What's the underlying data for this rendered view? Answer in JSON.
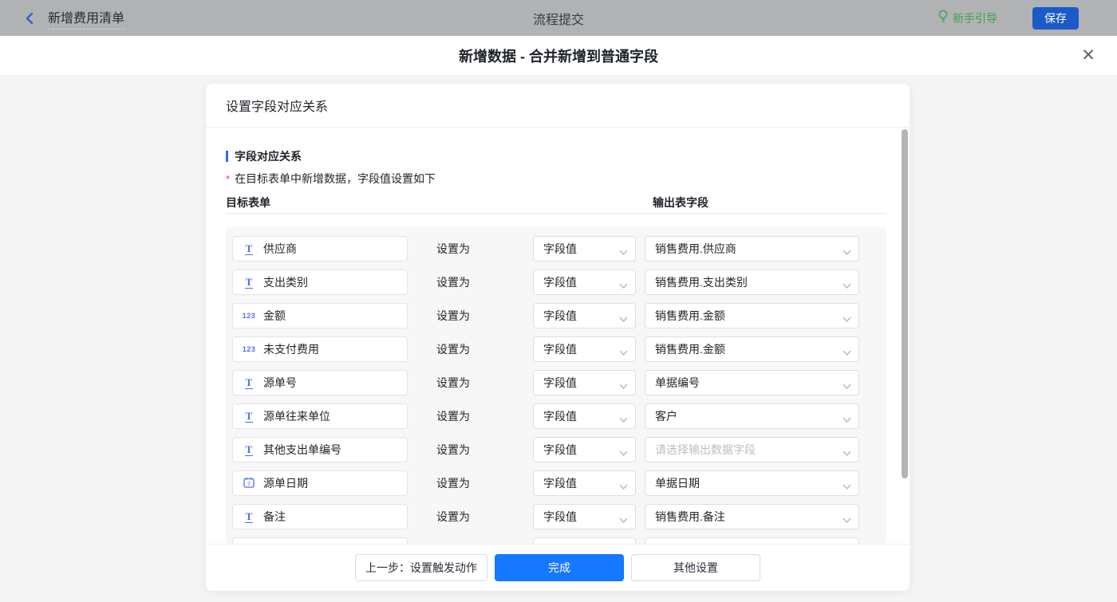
{
  "topbar": {
    "title": "新增费用清单",
    "center_title": "流程提交",
    "guide_label": "新手引导",
    "save_label": "保存"
  },
  "dialog": {
    "title": "新增数据 - 合并新增到普通字段",
    "close_glyph": "✕",
    "panel_title": "设置字段对应关系",
    "section_title": "字段对应关系",
    "note_mark": "*",
    "note": "在目标表单中新增数据，字段值设置如下",
    "col_left": "目标表单",
    "col_right": "输出表字段",
    "set_as_label": "设置为",
    "rows": [
      {
        "icon": "text",
        "field": "供应商",
        "mode": "字段值",
        "output": "销售费用.供应商",
        "is_placeholder": false
      },
      {
        "icon": "text",
        "field": "支出类别",
        "mode": "字段值",
        "output": "销售费用.支出类别",
        "is_placeholder": false
      },
      {
        "icon": "number",
        "field": "金额",
        "mode": "字段值",
        "output": "销售费用.金额",
        "is_placeholder": false
      },
      {
        "icon": "number",
        "field": "未支付费用",
        "mode": "字段值",
        "output": "销售费用.金额",
        "is_placeholder": false
      },
      {
        "icon": "text",
        "field": "源单号",
        "mode": "字段值",
        "output": "单据编号",
        "is_placeholder": false
      },
      {
        "icon": "text",
        "field": "源单往来单位",
        "mode": "字段值",
        "output": "客户",
        "is_placeholder": false
      },
      {
        "icon": "text",
        "field": "其他支出单编号",
        "mode": "字段值",
        "output": "请选择输出数据字段",
        "is_placeholder": true
      },
      {
        "icon": "date",
        "field": "源单日期",
        "mode": "字段值",
        "output": "单据日期",
        "is_placeholder": false
      },
      {
        "icon": "text",
        "field": "备注",
        "mode": "字段值",
        "output": "销售费用.备注",
        "is_placeholder": false
      },
      {
        "icon": "none",
        "field": "",
        "mode": "",
        "output": "",
        "is_placeholder": false,
        "partial": true
      }
    ],
    "footer": {
      "prev_label": "上一步：设置触发动作",
      "done_label": "完成",
      "other_label": "其他设置"
    }
  },
  "colors": {
    "primary_blue": "#1677ff",
    "save_button_blue": "#1a5bc7",
    "guide_green": "#3da24c",
    "field_icon_blue": "#4e6ef2",
    "topbar_dimmed_gray": "#b1b2b4",
    "placeholder_gray": "#b9bdc5"
  }
}
